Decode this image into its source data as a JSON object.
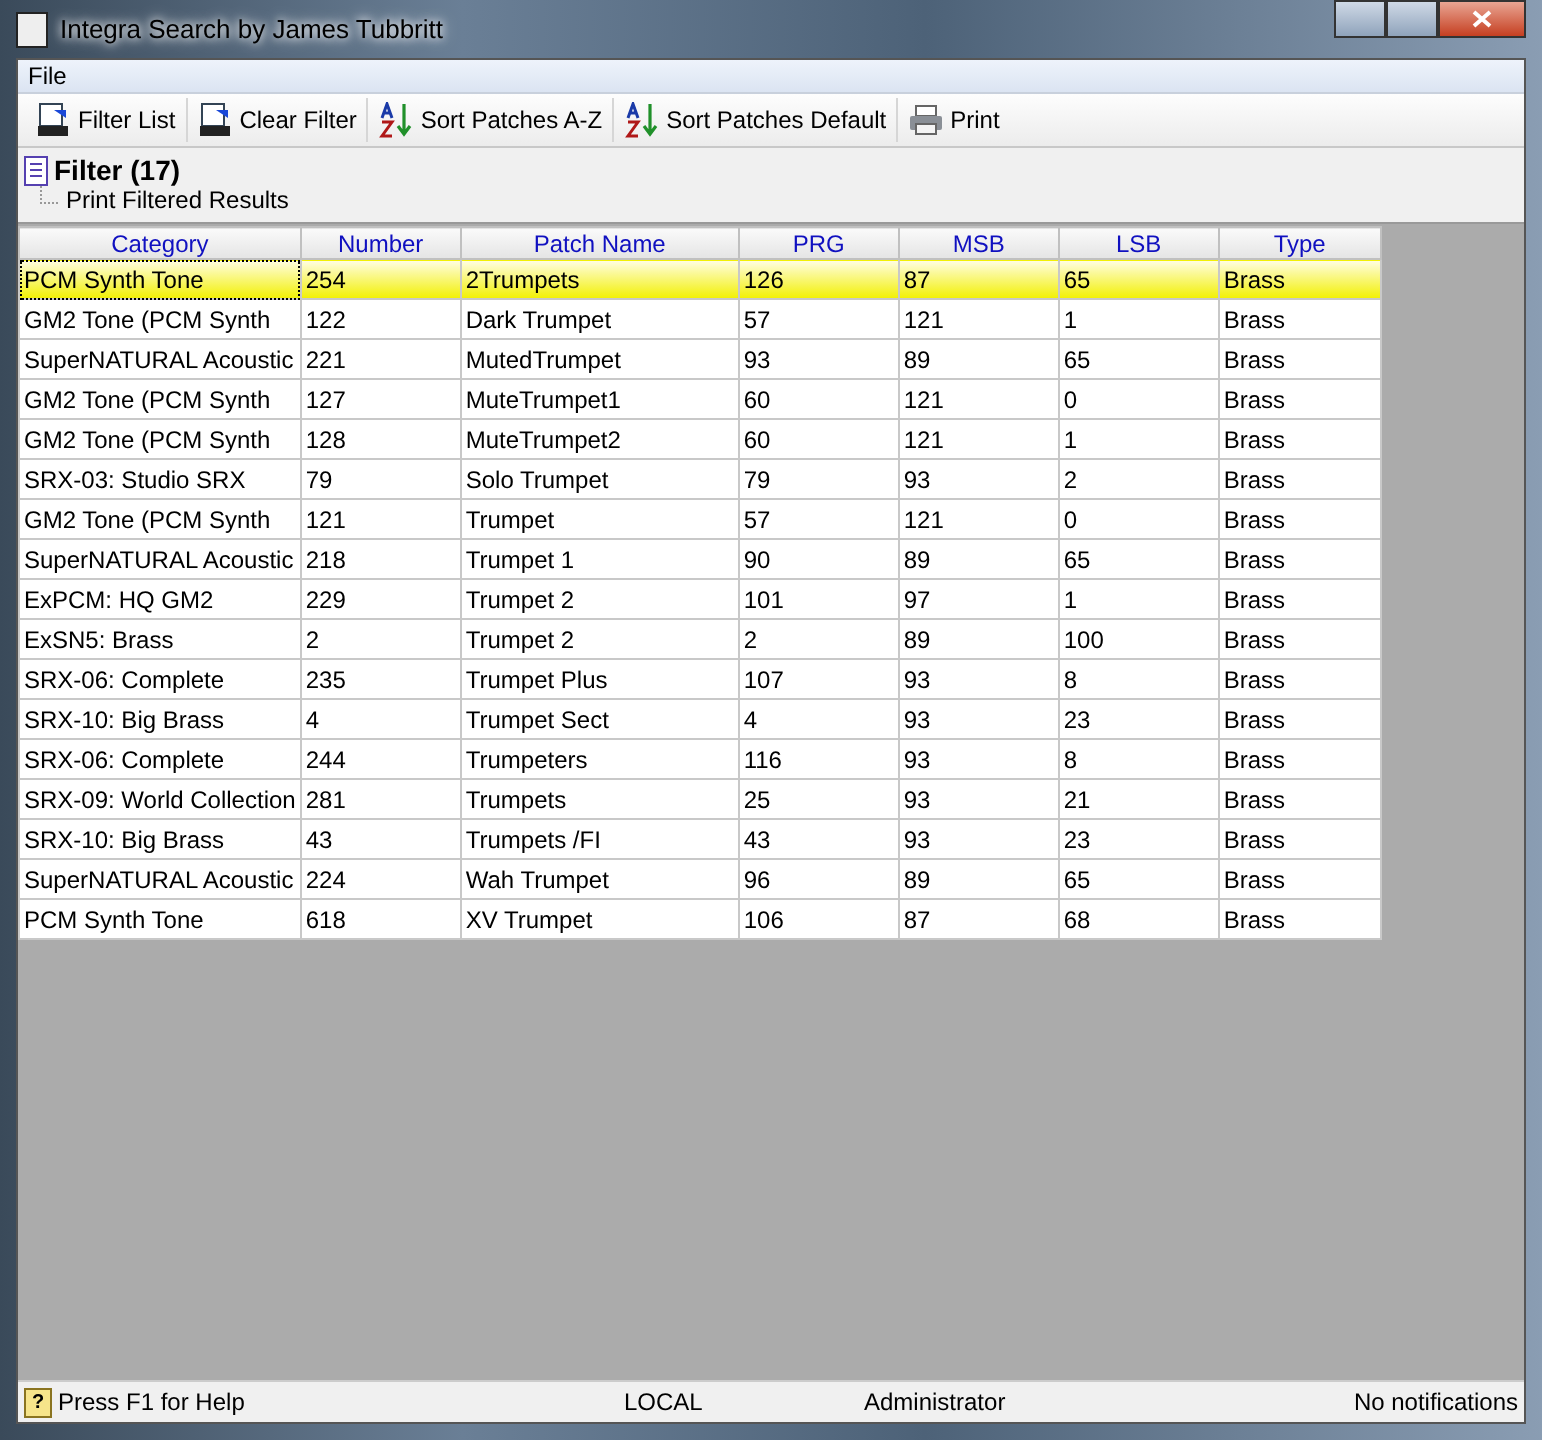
{
  "window": {
    "title": "Integra Search by James Tubbritt"
  },
  "menu": [
    "File"
  ],
  "toolbar": [
    {
      "label": "Filter List",
      "kind": "filter"
    },
    {
      "label": "Clear Filter",
      "kind": "filter"
    },
    {
      "label": "Sort Patches A-Z",
      "kind": "sort"
    },
    {
      "label": "Sort Patches Default",
      "kind": "sort"
    },
    {
      "label": "Print",
      "kind": "print"
    }
  ],
  "filter_panel": {
    "title": "Filter (17)",
    "items": [
      "Print Filtered Results"
    ]
  },
  "table": {
    "columns": [
      "Category",
      "Number",
      "Patch Name",
      "PRG",
      "MSB",
      "LSB",
      "Type"
    ],
    "rows": [
      {
        "selected": true,
        "cells": [
          "PCM Synth Tone",
          "254",
          "2Trumpets",
          "126",
          "87",
          "65",
          "Brass"
        ]
      },
      {
        "selected": false,
        "cells": [
          "GM2 Tone (PCM Synth",
          "122",
          "Dark Trumpet",
          "57",
          "121",
          "1",
          "Brass"
        ]
      },
      {
        "selected": false,
        "cells": [
          "SuperNATURAL Acoustic",
          "221",
          "MutedTrumpet",
          "93",
          "89",
          "65",
          "Brass"
        ]
      },
      {
        "selected": false,
        "cells": [
          "GM2 Tone (PCM Synth",
          "127",
          "MuteTrumpet1",
          "60",
          "121",
          "0",
          "Brass"
        ]
      },
      {
        "selected": false,
        "cells": [
          "GM2 Tone (PCM Synth",
          "128",
          "MuteTrumpet2",
          "60",
          "121",
          "1",
          "Brass"
        ]
      },
      {
        "selected": false,
        "cells": [
          "SRX-03: Studio SRX",
          "79",
          "Solo Trumpet",
          "79",
          "93",
          "2",
          "Brass"
        ]
      },
      {
        "selected": false,
        "cells": [
          "GM2 Tone (PCM Synth",
          "121",
          "Trumpet",
          "57",
          "121",
          "0",
          "Brass"
        ]
      },
      {
        "selected": false,
        "cells": [
          "SuperNATURAL Acoustic",
          "218",
          "Trumpet 1",
          "90",
          "89",
          "65",
          "Brass"
        ]
      },
      {
        "selected": false,
        "cells": [
          "ExPCM: HQ GM2",
          "229",
          "Trumpet 2",
          "101",
          "97",
          "1",
          "Brass"
        ]
      },
      {
        "selected": false,
        "cells": [
          "ExSN5: Brass",
          "2",
          "Trumpet 2",
          "2",
          "89",
          "100",
          "Brass"
        ]
      },
      {
        "selected": false,
        "cells": [
          "SRX-06: Complete",
          "235",
          "Trumpet Plus",
          "107",
          "93",
          "8",
          "Brass"
        ]
      },
      {
        "selected": false,
        "cells": [
          "SRX-10: Big Brass",
          "4",
          "Trumpet Sect",
          "4",
          "93",
          "23",
          "Brass"
        ]
      },
      {
        "selected": false,
        "cells": [
          "SRX-06: Complete",
          "244",
          "Trumpeters",
          "116",
          "93",
          "8",
          "Brass"
        ]
      },
      {
        "selected": false,
        "cells": [
          "SRX-09: World Collection",
          "281",
          "Trumpets",
          "25",
          "93",
          "21",
          "Brass"
        ]
      },
      {
        "selected": false,
        "cells": [
          "SRX-10: Big Brass",
          "43",
          "Trumpets /FI",
          "43",
          "93",
          "23",
          "Brass"
        ]
      },
      {
        "selected": false,
        "cells": [
          "SuperNATURAL Acoustic",
          "224",
          "Wah Trumpet",
          "96",
          "89",
          "65",
          "Brass"
        ]
      },
      {
        "selected": false,
        "cells": [
          "PCM Synth Tone",
          "618",
          "XV Trumpet",
          "106",
          "87",
          "68",
          "Brass"
        ]
      }
    ]
  },
  "status_bar": {
    "help_icon": "?",
    "help": "Press F1 for Help",
    "mode": "LOCAL",
    "user": "Administrator",
    "notifications": "No notifications"
  }
}
